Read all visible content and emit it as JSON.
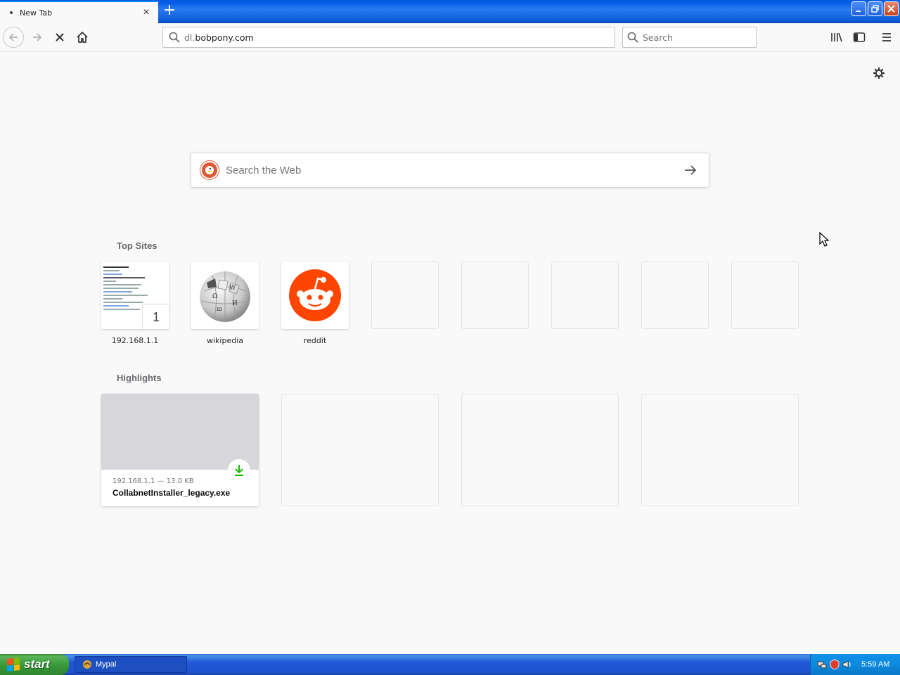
{
  "window": {
    "tab_title": "New Tab",
    "close_tab_glyph": "×",
    "new_tab_glyph": "+"
  },
  "toolbar": {
    "url_dim": "dl.",
    "url_main": "bobpony.com",
    "search_placeholder": "Search"
  },
  "newtab": {
    "web_search_placeholder": "Search the Web",
    "top_sites_title": "Top Sites",
    "top_sites": [
      {
        "label": "192.168.1.1",
        "badge": "1"
      },
      {
        "label": "wikipedia"
      },
      {
        "label": "reddit"
      }
    ],
    "highlights_title": "Highlights",
    "highlight": {
      "meta": "192.168.1.1 — 13.0 KB",
      "filename": "CollabnetInstaller_legacy.exe"
    }
  },
  "taskbar": {
    "start_label": "start",
    "task_label": "Mypal",
    "clock": "5:59 AM"
  },
  "colors": {
    "reddit": "#ff4500",
    "duckduckgo": "#de5833",
    "download_green": "#12bc00",
    "accent": "#0a84ff"
  }
}
